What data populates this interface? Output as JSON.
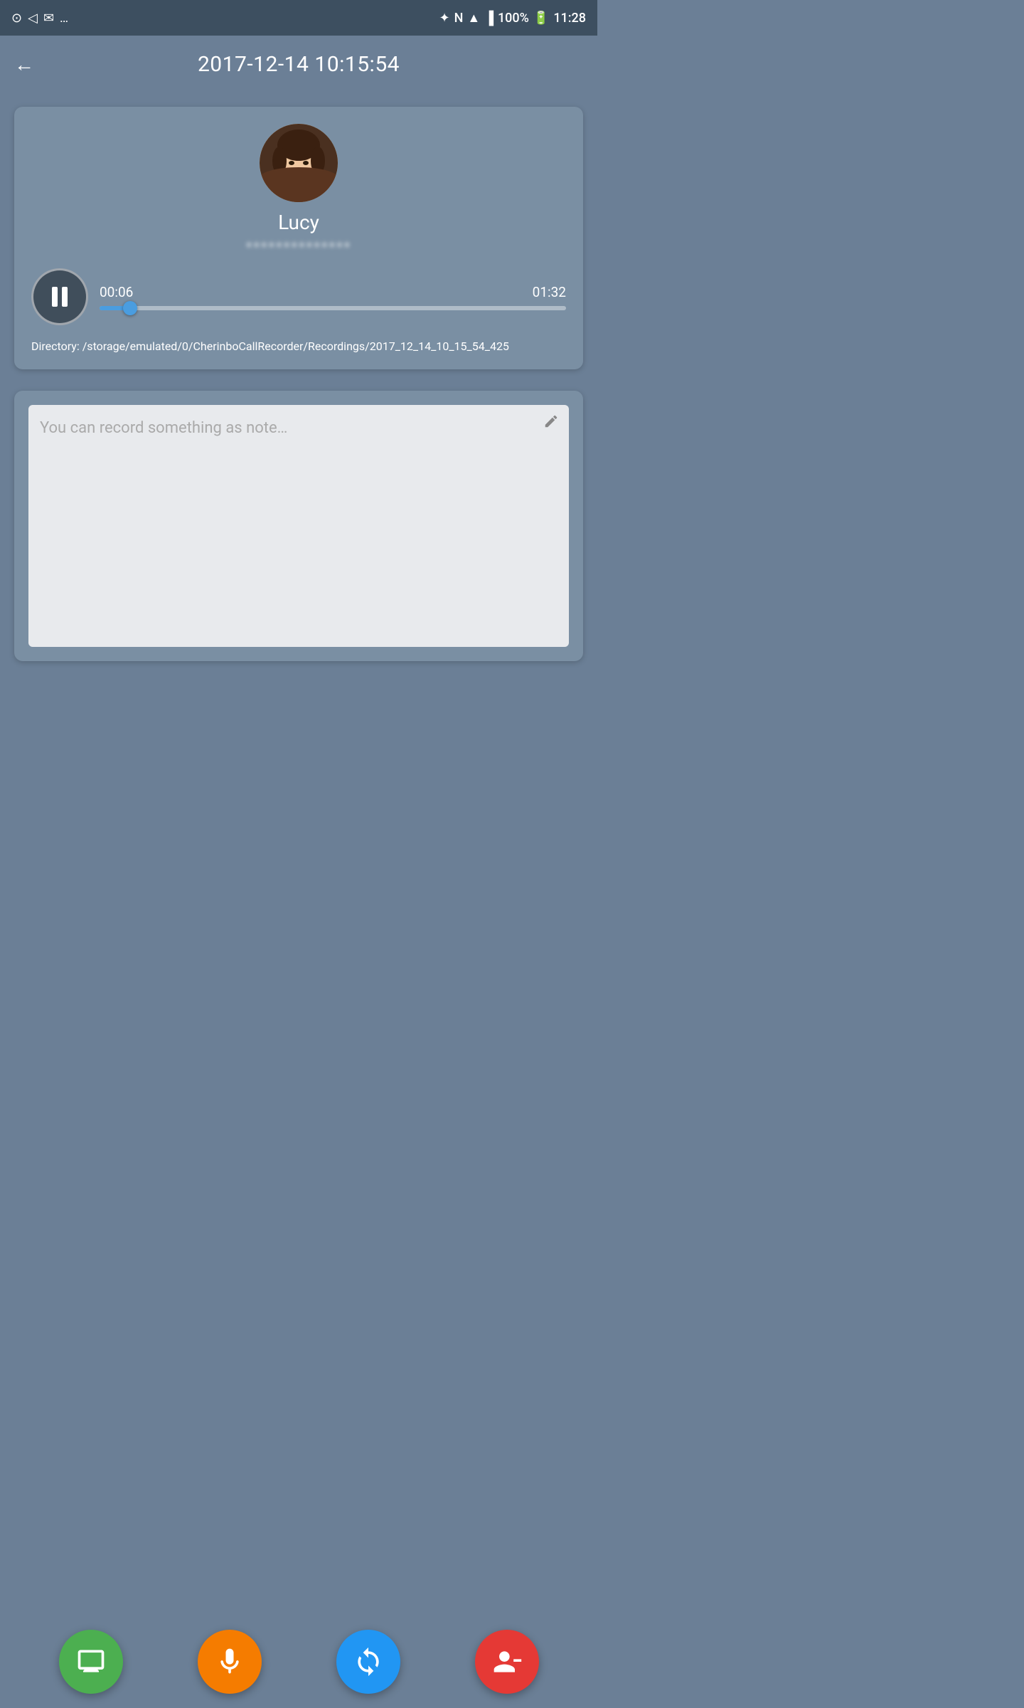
{
  "statusBar": {
    "time": "11:28",
    "battery": "100%",
    "icons": [
      "settings",
      "notification",
      "gmail",
      "more",
      "bluetooth",
      "nfc",
      "wifi",
      "signal",
      "battery"
    ]
  },
  "header": {
    "title": "2017-12-14 10:15:54",
    "backLabel": "←"
  },
  "player": {
    "contactName": "Lucy",
    "phoneNumber": "**************",
    "currentTime": "00:06",
    "totalTime": "01:32",
    "progressPercent": 6.5,
    "directory": "Directory: /storage/emulated/0/CherinboCallRecorder/Recordings/2017_12_14_10_15_54_425"
  },
  "notes": {
    "placeholder": "You can record something as note…"
  },
  "bottomBar": {
    "btn1Label": "screen",
    "btn2Label": "microphone",
    "btn3Label": "cloud-sync",
    "btn4Label": "remove-contact"
  }
}
